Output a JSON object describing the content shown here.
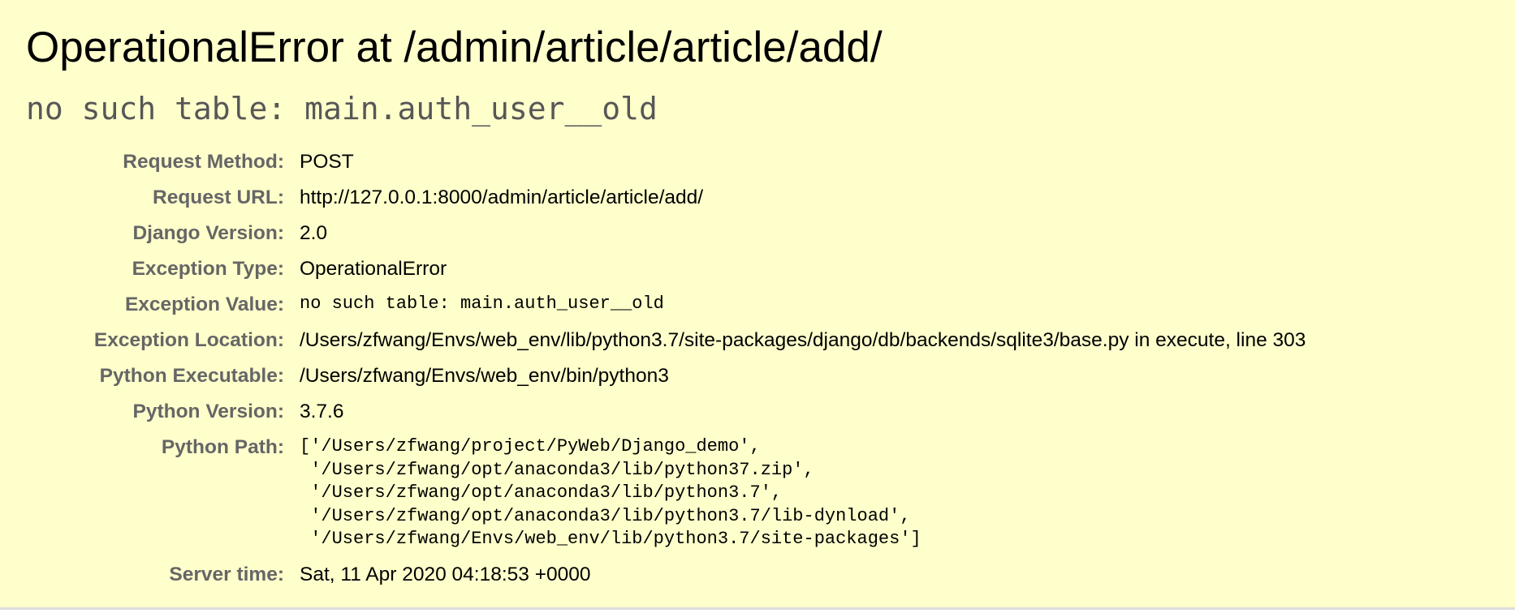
{
  "summary": {
    "title": "OperationalError at /admin/article/article/add/",
    "exception_value": "no such table: main.auth_user__old"
  },
  "meta": {
    "request_method": {
      "label": "Request Method:",
      "value": "POST"
    },
    "request_url": {
      "label": "Request URL:",
      "value": "http://127.0.0.1:8000/admin/article/article/add/"
    },
    "django_version": {
      "label": "Django Version:",
      "value": "2.0"
    },
    "exception_type": {
      "label": "Exception Type:",
      "value": "OperationalError"
    },
    "exception_value": {
      "label": "Exception Value:",
      "value": "no such table: main.auth_user__old"
    },
    "exception_location": {
      "label": "Exception Location:",
      "value": "/Users/zfwang/Envs/web_env/lib/python3.7/site-packages/django/db/backends/sqlite3/base.py in execute, line 303"
    },
    "python_executable": {
      "label": "Python Executable:",
      "value": "/Users/zfwang/Envs/web_env/bin/python3"
    },
    "python_version": {
      "label": "Python Version:",
      "value": "3.7.6"
    },
    "python_path": {
      "label": "Python Path:",
      "lines": [
        "['/Users/zfwang/project/PyWeb/Django_demo',",
        " '/Users/zfwang/opt/anaconda3/lib/python37.zip',",
        " '/Users/zfwang/opt/anaconda3/lib/python3.7',",
        " '/Users/zfwang/opt/anaconda3/lib/python3.7/lib-dynload',",
        " '/Users/zfwang/Envs/web_env/lib/python3.7/site-packages']"
      ]
    },
    "server_time": {
      "label": "Server time:",
      "value": "Sat, 11 Apr 2020 04:18:53 +0000"
    }
  },
  "colors": {
    "summary_background": "#ffffcc",
    "label_text": "#666666",
    "subtitle_text": "#575757"
  }
}
